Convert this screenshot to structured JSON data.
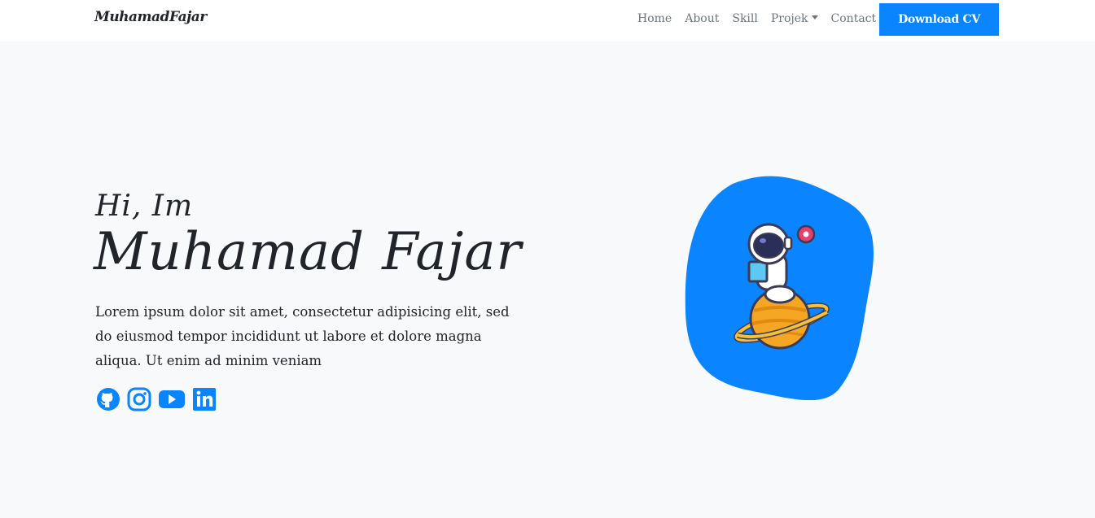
{
  "navbar": {
    "brand": "MuhamadFajar",
    "links": [
      {
        "label": "Home"
      },
      {
        "label": "About"
      },
      {
        "label": "Skill"
      },
      {
        "label": "Projek"
      },
      {
        "label": "Contact"
      }
    ],
    "cta_label": "Download CV"
  },
  "hero": {
    "greeting": "Hi, Im",
    "name": "Muhamad Fajar",
    "description": "Lorem ipsum dolor sit amet, consectetur adipisicing elit, sed do eiusmod tempor incididunt ut labore et dolore magna aliqua. Ut enim ad minim veniam",
    "socials": [
      "github-icon",
      "instagram-icon",
      "youtube-icon",
      "linkedin-icon"
    ],
    "illustration": "astronaut-reading-on-planet"
  },
  "colors": {
    "accent": "#0a84ff",
    "background": "#f8f9fa",
    "navbar": "#ffffff",
    "text": "#212529",
    "nav_text": "#6c757d"
  }
}
